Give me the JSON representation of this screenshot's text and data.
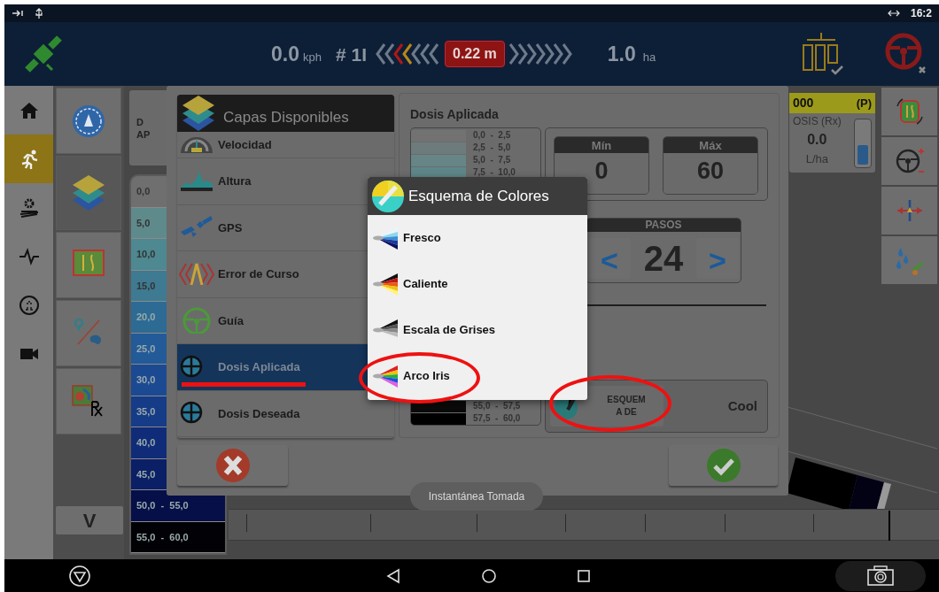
{
  "status_bar": {
    "time": "16:2"
  },
  "top_bar": {
    "speed": "0.0",
    "speed_unit": "kph",
    "swath": "# 1I",
    "offset": "0.22 m",
    "area": "1.0",
    "area_unit": "ha"
  },
  "left_nav": [
    {
      "kind": "home",
      "selected": false
    },
    {
      "kind": "run",
      "selected": true
    },
    {
      "kind": "settings",
      "selected": false
    },
    {
      "kind": "pulse",
      "selected": false
    },
    {
      "kind": "ut",
      "selected": false
    },
    {
      "kind": "camera",
      "selected": false
    }
  ],
  "tool_column": [
    {
      "kind": "compass",
      "selected": false
    },
    {
      "kind": "layers",
      "selected": true
    },
    {
      "kind": "guidance",
      "selected": false
    },
    {
      "kind": "boundary",
      "selected": false
    },
    {
      "kind": "rx",
      "selected": false
    }
  ],
  "v_button": "V",
  "map_legend": {
    "title_lines": [
      "D",
      "AP"
    ],
    "rows": [
      {
        "label": "0,0",
        "color": "#6f6f6f"
      },
      {
        "label": "5,0",
        "color": "#5f8a8c"
      },
      {
        "label": "10,0",
        "color": "#4e8890"
      },
      {
        "label": "15,0",
        "color": "#3e7a91"
      },
      {
        "label": "20,0",
        "color": "#2d6b94"
      },
      {
        "label": "25,0",
        "color": "#235a98"
      },
      {
        "label": "30,0",
        "color": "#1c4a92"
      },
      {
        "label": "35,0",
        "color": "#163b87"
      },
      {
        "label": "40,0",
        "color": "#102c78"
      },
      {
        "label": "45,0",
        "color": "#0b1f66"
      },
      {
        "label": "50,0  -  55,0",
        "color": "#060f48"
      },
      {
        "label": "55,0  -  60,0",
        "color": "#020206"
      }
    ]
  },
  "rate_panel": {
    "header": "000",
    "mode": "(P)",
    "label": "OSIS (Rx)",
    "value": "0.0",
    "unit": "L/ha",
    "level": 0.45
  },
  "right_tools": [
    {
      "kind": "auto-guidance"
    },
    {
      "kind": "steering"
    },
    {
      "kind": "nudge"
    },
    {
      "kind": "spray"
    }
  ],
  "layers_dialog": {
    "title": "Capas Disponibles",
    "layers": [
      {
        "label": "Velocidad",
        "kind": "speed",
        "selected": false
      },
      {
        "label": "Altura",
        "kind": "height",
        "selected": false
      },
      {
        "label": "GPS",
        "kind": "gps",
        "selected": false
      },
      {
        "label": "Error de Curso",
        "kind": "error",
        "selected": false
      },
      {
        "label": "Guía",
        "kind": "guide",
        "selected": false
      },
      {
        "label": "Dosis Aplicada",
        "kind": "rate",
        "selected": true
      },
      {
        "label": "Dosis Deseada",
        "kind": "rate",
        "selected": false
      }
    ],
    "detail": {
      "title": "Dosis Aplicada",
      "legend_top": [
        {
          "label": "0,0  -  2,5",
          "color": "#727272"
        },
        {
          "label": "2,5  -  5,0",
          "color": "#6d7b7c"
        },
        {
          "label": "5,0  -  7,5",
          "color": "#668587"
        },
        {
          "label": "7,5  -  10,0",
          "color": "#5e8688"
        }
      ],
      "legend_bottom": [
        {
          "label": "55,0  -  57,5",
          "color": "#0a0a0a"
        },
        {
          "label": "57,5  -  60,0",
          "color": "#000000"
        }
      ],
      "min_label": "Mín",
      "min": "0",
      "max_label": "Máx",
      "max": "60",
      "steps_label": "PASOS",
      "steps": "24",
      "prev": "<",
      "next": ">",
      "scheme_button": "ESQUEM A DE",
      "scheme": "Cool"
    }
  },
  "color_scheme_popup": {
    "title": "Esquema de Colores",
    "options": [
      {
        "label": "Fresco",
        "kind": "cool"
      },
      {
        "label": "Caliente",
        "kind": "hot"
      },
      {
        "label": "Escala de Grises",
        "kind": "gray"
      },
      {
        "label": "Arco Iris",
        "kind": "rainbow"
      }
    ]
  },
  "toast": "Instantánea Tomada",
  "annotations": [
    {
      "kind": "underline"
    },
    {
      "kind": "ellipse"
    },
    {
      "kind": "ellipse"
    }
  ]
}
